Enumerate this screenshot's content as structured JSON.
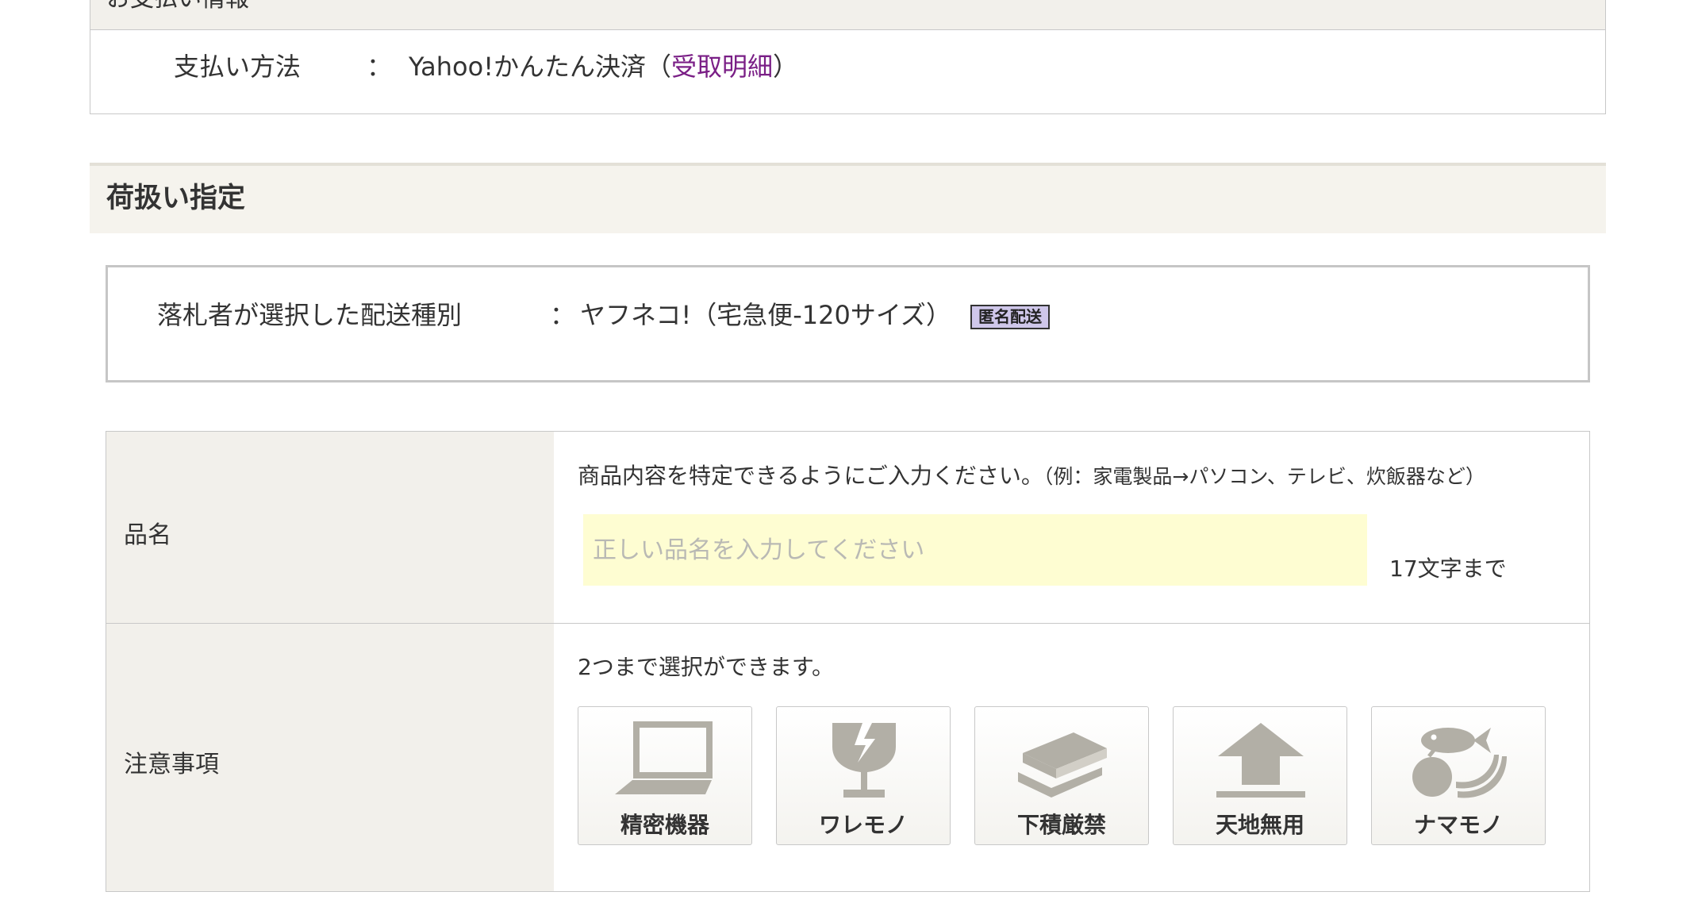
{
  "payment": {
    "section_title": "お支払い情報",
    "method_label": "支払い方法",
    "colon": "：",
    "method_value": "Yahoo!かんたん決済（",
    "receipt_link": "受取明細",
    "method_close": "）"
  },
  "handling": {
    "section_title": "荷扱い指定",
    "shipping_label": "落札者が選択した配送種別",
    "colon": "：",
    "shipping_value": "ヤフネコ!（宅急便-120サイズ）",
    "anonymous_badge": "匿名配送"
  },
  "form": {
    "item_name": {
      "label": "品名",
      "hint": "商品内容を特定できるようにご入力ください。",
      "hint_example": "（例：家電製品→パソコン、テレビ、炊飯器など）",
      "placeholder": "正しい品名を入力してください",
      "value": "",
      "limit": "17文字まで"
    },
    "notes": {
      "label": "注意事項",
      "hint": "2つまで選択ができます。",
      "options": [
        {
          "label": "精密機器",
          "icon": "laptop-icon"
        },
        {
          "label": "ワレモノ",
          "icon": "broken-glass-icon"
        },
        {
          "label": "下積厳禁",
          "icon": "stacked-items-icon"
        },
        {
          "label": "天地無用",
          "icon": "arrow-up-icon"
        },
        {
          "label": "ナマモノ",
          "icon": "fresh-food-icon"
        }
      ]
    }
  },
  "colors": {
    "icon_gray": "#b2afa6",
    "label_bg": "#f2f0eb",
    "input_bg": "#fefdd2",
    "link": "#7a1f86",
    "badge_bg": "#cfc7ea"
  }
}
